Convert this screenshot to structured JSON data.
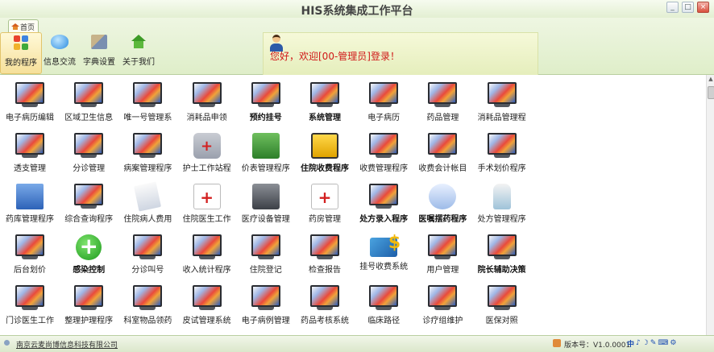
{
  "window": {
    "title": "HIS系统集成工作平台",
    "controls": [
      "_",
      "□",
      "×"
    ]
  },
  "ribbon": {
    "home_tab": "首页",
    "buttons": [
      {
        "label": "我的程序",
        "icon": "apps-grid-icon"
      },
      {
        "label": "信息交流",
        "icon": "chat-bubble-icon"
      },
      {
        "label": "字典设置",
        "icon": "tools-icon"
      },
      {
        "label": "关于我们",
        "icon": "home-icon"
      }
    ],
    "welcome": "您好，欢迎[00-管理员]登录！"
  },
  "programs": [
    {
      "label": "电子病历编辑",
      "icon": "monitor-icon",
      "bold": false
    },
    {
      "label": "区域卫生信息",
      "icon": "monitor-icon",
      "bold": false
    },
    {
      "label": "唯一号管理系",
      "icon": "monitor-icon",
      "bold": false
    },
    {
      "label": "消耗品申领",
      "icon": "monitor-icon",
      "bold": false
    },
    {
      "label": "预约挂号",
      "icon": "monitor-icon",
      "bold": true
    },
    {
      "label": "系统管理",
      "icon": "monitor-icon",
      "bold": true
    },
    {
      "label": "电子病历",
      "icon": "monitor-icon",
      "bold": false
    },
    {
      "label": "药品管理",
      "icon": "monitor-icon",
      "bold": false
    },
    {
      "label": "消耗品管理程",
      "icon": "monitor-icon",
      "bold": false
    },
    {
      "label": "透支管理",
      "icon": "monitor-icon",
      "bold": false
    },
    {
      "label": "分诊管理",
      "icon": "monitor-icon",
      "bold": false
    },
    {
      "label": "病案管理程序",
      "icon": "monitor-icon",
      "bold": false
    },
    {
      "label": "护士工作站程",
      "icon": "nurse-icon",
      "bold": false
    },
    {
      "label": "价表管理程序",
      "icon": "money-icon",
      "bold": false
    },
    {
      "label": "住院收费程序",
      "icon": "cash-box-icon",
      "bold": true
    },
    {
      "label": "收费管理程序",
      "icon": "monitor-icon",
      "bold": false
    },
    {
      "label": "收费会计帐目",
      "icon": "monitor-icon",
      "bold": false
    },
    {
      "label": "手术划价程序",
      "icon": "monitor-icon",
      "bold": false
    },
    {
      "label": "药库管理程序",
      "icon": "building-icon",
      "bold": false
    },
    {
      "label": "综合查询程序",
      "icon": "monitor-icon",
      "bold": false
    },
    {
      "label": "住院病人费用",
      "icon": "notepad-icon",
      "bold": false
    },
    {
      "label": "住院医生工作",
      "icon": "medical-record-icon",
      "bold": false
    },
    {
      "label": "医疗设备管理",
      "icon": "ambulance-house-icon",
      "bold": false
    },
    {
      "label": "药房管理",
      "icon": "first-aid-icon",
      "bold": false
    },
    {
      "label": "处方录入程序",
      "icon": "monitor-icon",
      "bold": true
    },
    {
      "label": "医嘱摆药程序",
      "icon": "pills-icon",
      "bold": true
    },
    {
      "label": "处方管理程序",
      "icon": "bottle-icon",
      "bold": false
    },
    {
      "label": "后台划价",
      "icon": "monitor-icon",
      "bold": false
    },
    {
      "label": "感染控制",
      "icon": "green-plus-icon",
      "bold": true
    },
    {
      "label": "分诊叫号",
      "icon": "monitor-icon",
      "bold": false
    },
    {
      "label": "收入统计程序",
      "icon": "monitor-icon",
      "bold": false
    },
    {
      "label": "住院登记",
      "icon": "monitor-icon",
      "bold": false
    },
    {
      "label": "检查报告",
      "icon": "monitor-icon",
      "bold": false
    },
    {
      "label": "挂号收费系统",
      "icon": "card-dollar-icon",
      "bold": false
    },
    {
      "label": "用户管理",
      "icon": "monitor-icon",
      "bold": false
    },
    {
      "label": "院长辅助决策",
      "icon": "monitor-icon",
      "bold": true
    },
    {
      "label": "门诊医生工作",
      "icon": "monitor-icon",
      "bold": false
    },
    {
      "label": "整理护理程序",
      "icon": "monitor-icon",
      "bold": false
    },
    {
      "label": "科室物品领药",
      "icon": "monitor-icon",
      "bold": false
    },
    {
      "label": "皮试管理系统",
      "icon": "monitor-icon",
      "bold": false
    },
    {
      "label": "电子病例管理",
      "icon": "monitor-icon",
      "bold": false
    },
    {
      "label": "药品考核系统",
      "icon": "monitor-icon",
      "bold": false
    },
    {
      "label": "临床路径",
      "icon": "monitor-icon",
      "bold": false
    },
    {
      "label": "诊疗组维护",
      "icon": "monitor-icon",
      "bold": false
    },
    {
      "label": "医保对照",
      "icon": "monitor-icon",
      "bold": false
    }
  ],
  "status": {
    "company": "南京云麦尚博信息科技有限公司",
    "version": "版本号：V1.0.0001",
    "ime": [
      "中",
      "♪",
      "☽",
      "✎",
      "⌨",
      "⚙"
    ]
  }
}
